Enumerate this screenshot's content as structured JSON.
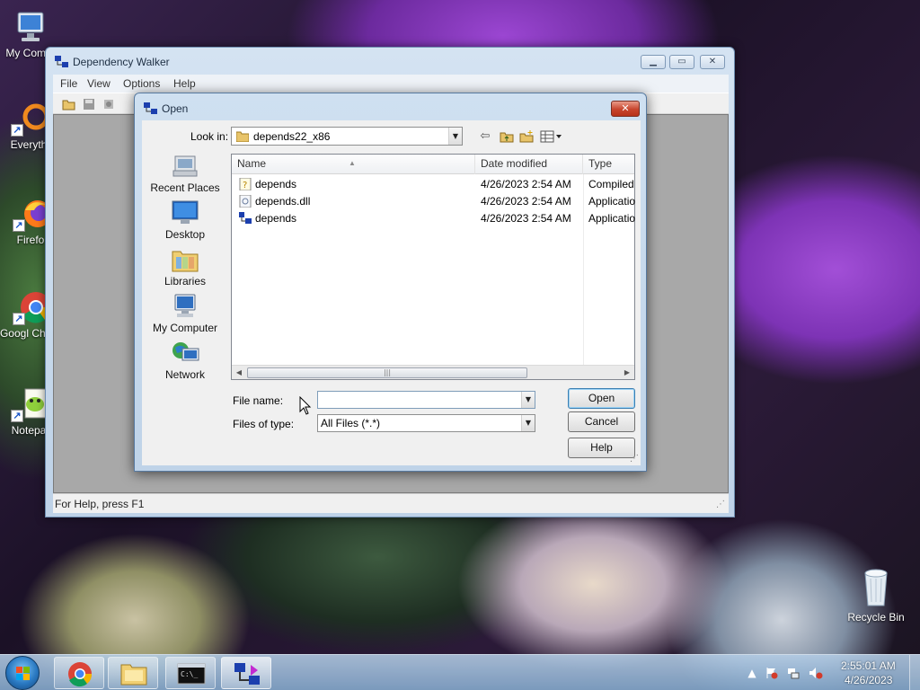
{
  "desktop": {
    "icons": [
      {
        "name": "my-computer",
        "label": "My Comp"
      },
      {
        "name": "everything",
        "label": "Everyth"
      },
      {
        "name": "firefox",
        "label": "Firefo"
      },
      {
        "name": "google-chrome",
        "label": "Googl Chron"
      },
      {
        "name": "notepad",
        "label": "Notepa"
      },
      {
        "name": "recycle-bin",
        "label": "Recycle Bin"
      }
    ]
  },
  "main_window": {
    "title": "Dependency Walker",
    "menu": [
      "File",
      "View",
      "Options",
      "Help"
    ],
    "status_text": "For Help, press F1"
  },
  "open_dialog": {
    "title": "Open",
    "look_in_label": "Look in:",
    "look_in_value": "depends22_x86",
    "places": [
      "Recent Places",
      "Desktop",
      "Libraries",
      "My Computer",
      "Network"
    ],
    "columns": [
      "Name",
      "Date modified",
      "Type"
    ],
    "files": [
      {
        "name": "depends",
        "date": "4/26/2023 2:54 AM",
        "type": "Compiled",
        "icon": "help-file-icon"
      },
      {
        "name": "depends.dll",
        "date": "4/26/2023 2:54 AM",
        "type": "Applicatio",
        "icon": "dll-file-icon"
      },
      {
        "name": "depends",
        "date": "4/26/2023 2:54 AM",
        "type": "Applicatio",
        "icon": "app-exe-icon"
      }
    ],
    "file_name_label": "File name:",
    "file_name_value": "",
    "files_of_type_label": "Files of type:",
    "files_of_type_value": "All Files (*.*)",
    "buttons": {
      "open": "Open",
      "cancel": "Cancel",
      "help": "Help"
    }
  },
  "taskbar": {
    "time": "2:55:01 AM",
    "date": "4/26/2023"
  }
}
